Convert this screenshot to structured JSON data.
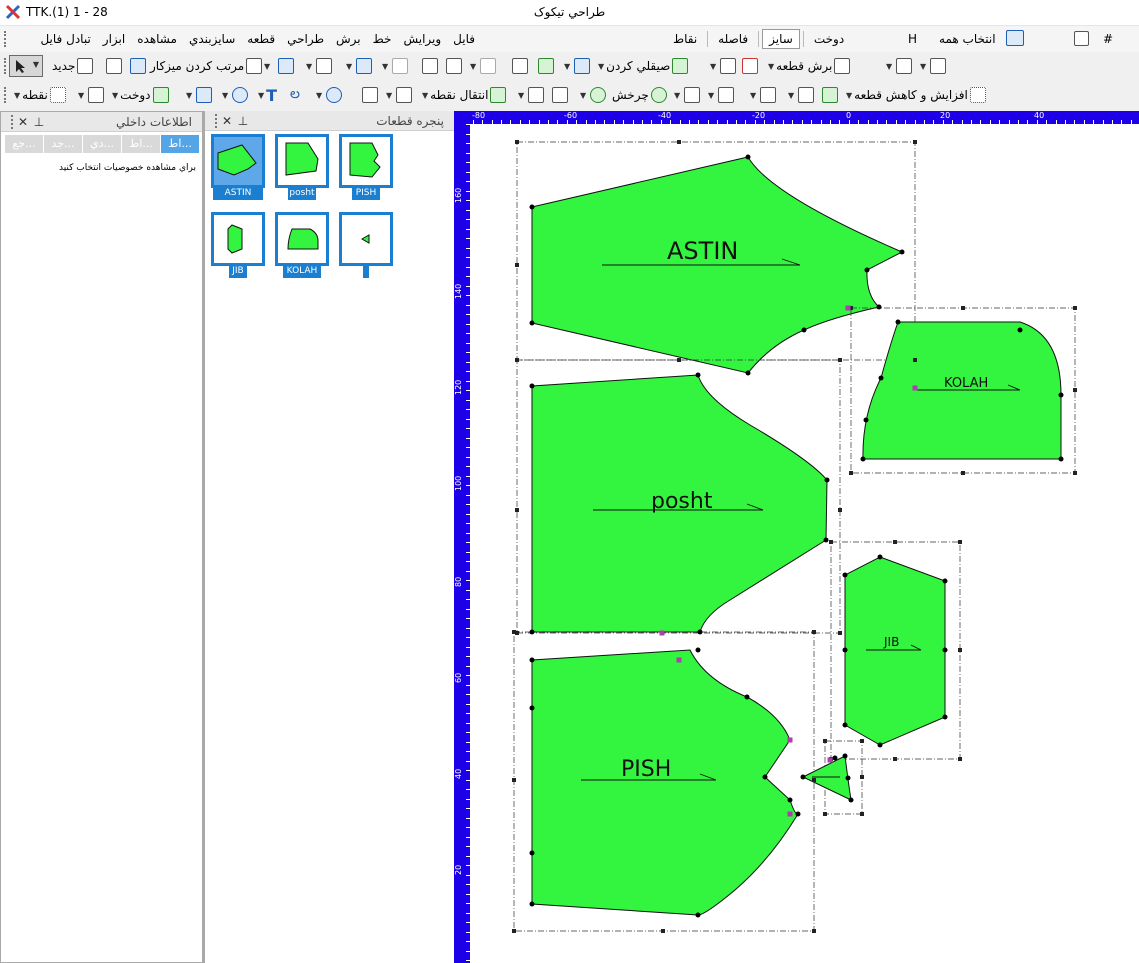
{
  "titlebar": {
    "doc": "TTK.(1) 1 - 28",
    "title": "طراحي تيكوک"
  },
  "menu": {
    "items": [
      "فايل",
      "ويرايش",
      "خط",
      "برش",
      "طراحي",
      "قطعه",
      "سايزبندي",
      "مشاهده",
      "ابزار",
      "تبادل فايل"
    ]
  },
  "modes": {
    "items": [
      {
        "label": "دوخت",
        "active": false
      },
      {
        "label": "سايز",
        "active": true
      },
      {
        "label": "فاصله",
        "active": false
      },
      {
        "label": "نقاط",
        "active": false
      }
    ]
  },
  "right_tools": {
    "select_all": "انتخاب همه",
    "h": "H",
    "hash": "#"
  },
  "toolbar1": {
    "new": "جديد",
    "arrange": "مرتب كردن ميزكار",
    "smooth": "صيقلي كردن",
    "cut_piece": "برش قطعه"
  },
  "toolbar2": {
    "point": "نقطه",
    "sew": "دوخت",
    "move_point": "انتقال نقطه",
    "rotate": "چرخش",
    "resize_piece": "افزايش و كاهش قطعه"
  },
  "left_panel": {
    "title": "اطلاعات داخلي",
    "tabs": [
      "...اط",
      "...اط",
      "...دي",
      "...جد",
      "...جع"
    ],
    "hint": "براي مشاهده خصوصيات انتخاب كنيد"
  },
  "pieces_panel": {
    "title": "پنجره قطعات",
    "thumbs": [
      {
        "label": "ASTIN",
        "selected": true
      },
      {
        "label": "posht",
        "selected": false
      },
      {
        "label": "PISH",
        "selected": false
      },
      {
        "label": "JIB",
        "selected": false
      },
      {
        "label": "KOLAH",
        "selected": false
      },
      {
        "label": "",
        "selected": false
      }
    ]
  },
  "rulers": {
    "top": [
      "-80",
      "-60",
      "-40",
      "-20",
      "0",
      "20",
      "40"
    ],
    "left": [
      "160",
      "140",
      "120",
      "100",
      "80",
      "60",
      "40",
      "20"
    ]
  },
  "pieces": {
    "astin": "ASTIN",
    "posht": "posht",
    "pish": "PISH",
    "kolah": "KOLAH",
    "jib": "JIB"
  },
  "colors": {
    "piece_fill": "#33f53f",
    "ruler": "#1d00e8",
    "accent": "#1a7fd0"
  }
}
